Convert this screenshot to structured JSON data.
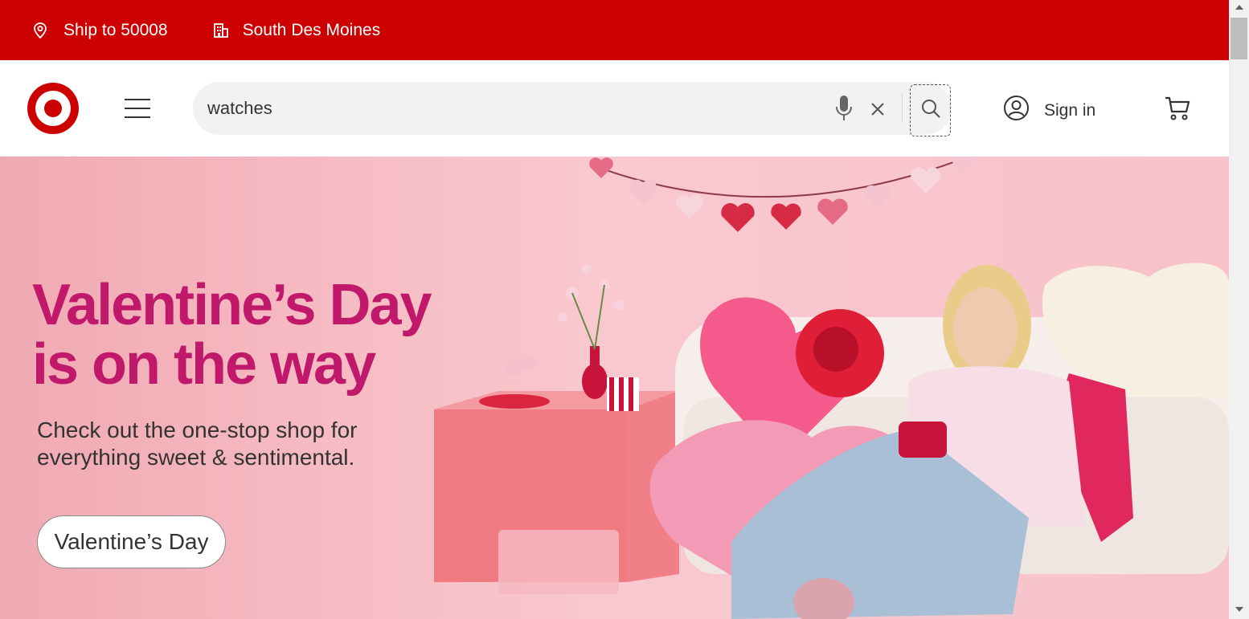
{
  "topbar": {
    "ship_label": "Ship to 50008",
    "ship_icon": "location-pin-icon",
    "store_label": "South Des Moines",
    "store_icon": "store-icon"
  },
  "header": {
    "logo": "target-bullseye-logo",
    "menu_icon": "hamburger-menu-icon",
    "search": {
      "value": "watches",
      "mic_icon": "microphone-icon",
      "clear_icon": "close-icon",
      "submit_icon": "search-icon"
    },
    "signin_label": "Sign in",
    "account_icon": "account-icon",
    "cart_icon": "cart-icon"
  },
  "hero": {
    "headline_line1": "Valentine’s Day",
    "headline_line2": "is on the way",
    "subtext": "Check out the one-stop shop for everything sweet & sentimental.",
    "cta_label": "Valentine’s Day"
  },
  "colors": {
    "brand_red": "#cc0000",
    "headline_magenta": "#c0186a",
    "hero_pink": "#f7c2c9"
  }
}
